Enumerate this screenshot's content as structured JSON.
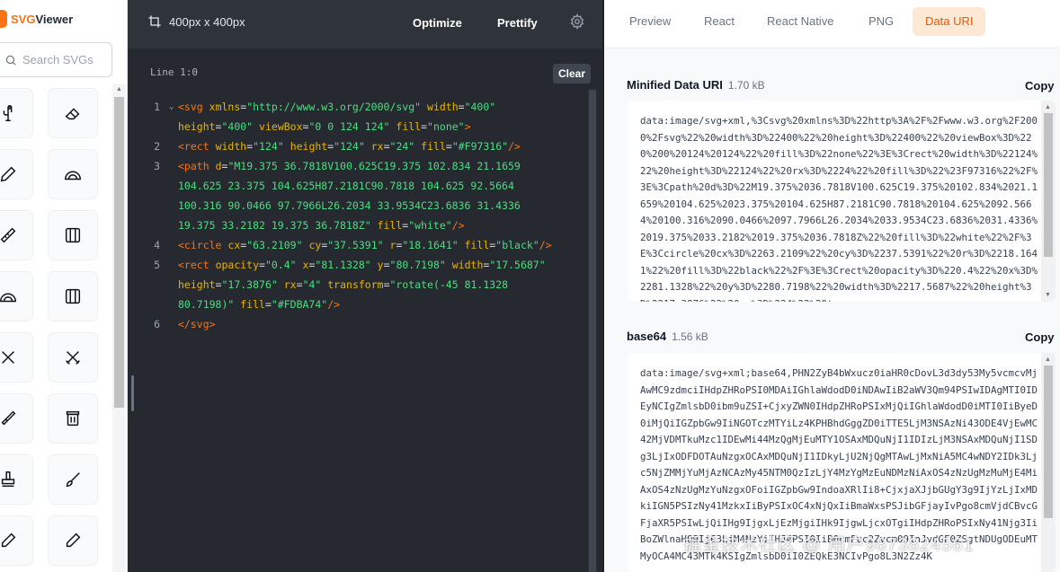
{
  "app": {
    "logo_svg": "SVG",
    "logo_rest": "Viewer"
  },
  "sidebar": {
    "search_placeholder": "Search SVGs",
    "icons": [
      "cactus-icon",
      "eraser-icon",
      "pen-icon",
      "protractor-icon",
      "ruler-icon",
      "paint-palette-icon",
      "protractor-icon",
      "paint-palette-icon",
      "scissors-icon",
      "crossed-swords-icon",
      "brush-icon",
      "paint-jar-icon",
      "stamp-icon",
      "paintbrush-icon",
      "marker-icon",
      "marker-icon"
    ]
  },
  "editor": {
    "dimensions": "400px x 400px",
    "optimize_label": "Optimize",
    "prettify_label": "Prettify",
    "line_info": "Line 1:0",
    "clear_label": "Clear",
    "code_lines": [
      {
        "n": "1",
        "fold": true,
        "html": "<span class=\"tag\">&lt;svg</span> <span class=\"attr\">xmlns</span>=<span class=\"str\">\"http://www.w3.org/2000/svg\"</span> <span class=\"attr\">width</span>=<span class=\"str\">\"400\"</span>\n<span class=\"attr\">height</span>=<span class=\"str\">\"400\"</span> <span class=\"attr\">viewBox</span>=<span class=\"str\">\"0 0 124 124\"</span> <span class=\"attr\">fill</span>=<span class=\"str\">\"none\"</span><span class=\"tag\">&gt;</span>"
      },
      {
        "n": "2",
        "fold": false,
        "html": "<span class=\"tag\">&lt;rect</span> <span class=\"attr\">width</span>=<span class=\"str\">\"124\"</span> <span class=\"attr\">height</span>=<span class=\"str\">\"124\"</span> <span class=\"attr\">rx</span>=<span class=\"str\">\"24\"</span> <span class=\"attr\">fill</span>=<span class=\"str\">\"#F97316\"</span><span class=\"tag\">/&gt;</span>"
      },
      {
        "n": "3",
        "fold": false,
        "html": "<span class=\"tag\">&lt;path</span> <span class=\"attr\">d</span>=<span class=\"str\">\"M19.375 36.7818V100.625C19.375 102.834 21.1659\n104.625 23.375 104.625H87.2181C90.7818 104.625 92.5664\n100.316 90.0466 97.7966L26.2034 33.9534C23.6836 31.4336\n19.375 33.2182 19.375 36.7818Z\"</span> <span class=\"attr\">fill</span>=<span class=\"str\">\"white\"</span><span class=\"tag\">/&gt;</span>"
      },
      {
        "n": "4",
        "fold": false,
        "html": "<span class=\"tag\">&lt;circle</span> <span class=\"attr\">cx</span>=<span class=\"str\">\"63.2109\"</span> <span class=\"attr\">cy</span>=<span class=\"str\">\"37.5391\"</span> <span class=\"attr\">r</span>=<span class=\"str\">\"18.1641\"</span> <span class=\"attr\">fill</span>=<span class=\"str\">\"black\"</span><span class=\"tag\">/&gt;</span>"
      },
      {
        "n": "5",
        "fold": false,
        "html": "<span class=\"tag\">&lt;rect</span> <span class=\"attr\">opacity</span>=<span class=\"str\">\"0.4\"</span> <span class=\"attr\">x</span>=<span class=\"str\">\"81.1328\"</span> <span class=\"attr\">y</span>=<span class=\"str\">\"80.7198\"</span> <span class=\"attr\">width</span>=<span class=\"str\">\"17.5687\"</span>\n<span class=\"attr\">height</span>=<span class=\"str\">\"17.3876\"</span> <span class=\"attr\">rx</span>=<span class=\"str\">\"4\"</span> <span class=\"attr\">transform</span>=<span class=\"str\">\"rotate(-45 81.1328\n80.7198)\"</span> <span class=\"attr\">fill</span>=<span class=\"str\">\"#FDBA74\"</span><span class=\"tag\">/&gt;</span>"
      },
      {
        "n": "6",
        "fold": false,
        "html": "<span class=\"tag\">&lt;/svg&gt;</span>"
      }
    ]
  },
  "tabs": [
    "Preview",
    "React",
    "React Native",
    "PNG",
    "Data URI"
  ],
  "active_tab": "Data URI",
  "minified": {
    "title": "Minified Data URI",
    "size": "1.70 kB",
    "copy_label": "Copy",
    "text": "data:image/svg+xml,%3Csvg%20xmlns%3D%22http%3A%2F%2Fwww.w3.org%2F2000%2Fsvg%22%20width%3D%22400%22%20height%3D%22400%22%20viewBox%3D%220%200%20124%20124%22%20fill%3D%22none%22%3E%3Crect%20width%3D%22124%22%20height%3D%22124%22%20rx%3D%2224%22%20fill%3D%22%23F97316%22%2F%3E%3Cpath%20d%3D%22M19.375%2036.7818V100.625C19.375%20102.834%2021.1659%20104.625%2023.375%20104.625H87.2181C90.7818%20104.625%2092.5664%20100.316%2090.0466%2097.7966L26.2034%2033.9534C23.6836%2031.4336%2019.375%2033.2182%2019.375%2036.7818Z%22%20fill%3D%22white%22%2F%3E%3Ccircle%20cx%3D%2263.2109%22%20cy%3D%2237.5391%22%20r%3D%2218.1641%22%20fill%3D%22black%22%2F%3E%3Crect%20opacity%3D%220.4%22%20x%3D%2281.1328%22%20y%3D%2280.7198%22%20width%3D%2217.5687%22%20height%3D%2217.3876%22%20rx%3D%224%22%20tran"
  },
  "base64": {
    "title": "base64",
    "size": "1.56 kB",
    "copy_label": "Copy",
    "text": "data:image/svg+xml;base64,PHN2ZyB4bWxucz0iaHR0cDovL3d3dy53My5vcmcvMjAwMC9zdmciIHdpZHRoPSI0MDAiIGhlaWdodD0iNDAwIiB2aWV3Qm94PSIwIDAgMTI0IDEyNCIgZmlsbD0ibm9uZSI+CjxyZWN0IHdpZHRoPSIxMjQiIGhlaWdodD0iMTI0IiByeD0iMjQiIGZpbGw9IiNGOTczMTYiLz4KPHBhdGggZD0iTTE5LjM3NSAzNi43ODE4VjEwMC42MjVDMTkuMzc1IDEwMi44MzQgMjEuMTY1OSAxMDQuNjI1IDIzLjM3NSAxMDQuNjI1SDg3LjIxODFDOTAuNzgxOCAxMDQuNjI1IDkyLjU2NjQgMTAwLjMxNiA5MC4wNDY2IDk3Ljc5NjZMMjYuMjAzNCAzMy45NTM0QzIzLjY4MzYgMzEuNDMzNiAxOS4zNzUgMzMuMjE4MiAxOS4zNzUgMzYuNzgxOFoiIGZpbGw9IndoaXRlIi8+CjxjaXJjbGUgY3g9IjYzLjIxMDkiIGN5PSIzNy41MzkxIiByPSIxOC4xNjQxIiBmaWxsPSJibGFjayIvPgo8cmVjdCBvcGFjaXR5PSIwLjQiIHg9IjgxLjEzMjgiIHk9IjgwLjcxOTgiIHdpZHRoPSIxNy41Njg3IiBoZWlnaHQ9IjE3LjM4NzYiIHJ4PSI0IiB0cmFuc2Zvcm09InJvdGF0ZSgtNDUgODEuMTMyOCA4MC43MTk4KSIgZmlsbD0iI0ZEQkE3NCIvPgo8L3N2Zz4K"
  },
  "watermark": "掘金技术社区 @ 用户9873824561",
  "colors": {
    "accent": "#f97316",
    "editor_bg": "#262a30",
    "active_tab_bg": "#fde8d4"
  }
}
